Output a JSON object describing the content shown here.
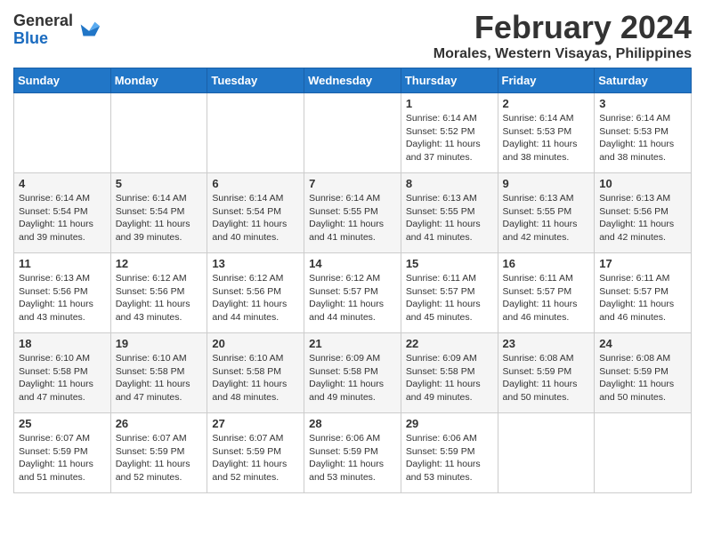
{
  "logo": {
    "general": "General",
    "blue": "Blue"
  },
  "title": {
    "month_year": "February 2024",
    "location": "Morales, Western Visayas, Philippines"
  },
  "headers": [
    "Sunday",
    "Monday",
    "Tuesday",
    "Wednesday",
    "Thursday",
    "Friday",
    "Saturday"
  ],
  "weeks": [
    [
      {
        "day": "",
        "info": ""
      },
      {
        "day": "",
        "info": ""
      },
      {
        "day": "",
        "info": ""
      },
      {
        "day": "",
        "info": ""
      },
      {
        "day": "1",
        "info": "Sunrise: 6:14 AM\nSunset: 5:52 PM\nDaylight: 11 hours\nand 37 minutes."
      },
      {
        "day": "2",
        "info": "Sunrise: 6:14 AM\nSunset: 5:53 PM\nDaylight: 11 hours\nand 38 minutes."
      },
      {
        "day": "3",
        "info": "Sunrise: 6:14 AM\nSunset: 5:53 PM\nDaylight: 11 hours\nand 38 minutes."
      }
    ],
    [
      {
        "day": "4",
        "info": "Sunrise: 6:14 AM\nSunset: 5:54 PM\nDaylight: 11 hours\nand 39 minutes."
      },
      {
        "day": "5",
        "info": "Sunrise: 6:14 AM\nSunset: 5:54 PM\nDaylight: 11 hours\nand 39 minutes."
      },
      {
        "day": "6",
        "info": "Sunrise: 6:14 AM\nSunset: 5:54 PM\nDaylight: 11 hours\nand 40 minutes."
      },
      {
        "day": "7",
        "info": "Sunrise: 6:14 AM\nSunset: 5:55 PM\nDaylight: 11 hours\nand 41 minutes."
      },
      {
        "day": "8",
        "info": "Sunrise: 6:13 AM\nSunset: 5:55 PM\nDaylight: 11 hours\nand 41 minutes."
      },
      {
        "day": "9",
        "info": "Sunrise: 6:13 AM\nSunset: 5:55 PM\nDaylight: 11 hours\nand 42 minutes."
      },
      {
        "day": "10",
        "info": "Sunrise: 6:13 AM\nSunset: 5:56 PM\nDaylight: 11 hours\nand 42 minutes."
      }
    ],
    [
      {
        "day": "11",
        "info": "Sunrise: 6:13 AM\nSunset: 5:56 PM\nDaylight: 11 hours\nand 43 minutes."
      },
      {
        "day": "12",
        "info": "Sunrise: 6:12 AM\nSunset: 5:56 PM\nDaylight: 11 hours\nand 43 minutes."
      },
      {
        "day": "13",
        "info": "Sunrise: 6:12 AM\nSunset: 5:56 PM\nDaylight: 11 hours\nand 44 minutes."
      },
      {
        "day": "14",
        "info": "Sunrise: 6:12 AM\nSunset: 5:57 PM\nDaylight: 11 hours\nand 44 minutes."
      },
      {
        "day": "15",
        "info": "Sunrise: 6:11 AM\nSunset: 5:57 PM\nDaylight: 11 hours\nand 45 minutes."
      },
      {
        "day": "16",
        "info": "Sunrise: 6:11 AM\nSunset: 5:57 PM\nDaylight: 11 hours\nand 46 minutes."
      },
      {
        "day": "17",
        "info": "Sunrise: 6:11 AM\nSunset: 5:57 PM\nDaylight: 11 hours\nand 46 minutes."
      }
    ],
    [
      {
        "day": "18",
        "info": "Sunrise: 6:10 AM\nSunset: 5:58 PM\nDaylight: 11 hours\nand 47 minutes."
      },
      {
        "day": "19",
        "info": "Sunrise: 6:10 AM\nSunset: 5:58 PM\nDaylight: 11 hours\nand 47 minutes."
      },
      {
        "day": "20",
        "info": "Sunrise: 6:10 AM\nSunset: 5:58 PM\nDaylight: 11 hours\nand 48 minutes."
      },
      {
        "day": "21",
        "info": "Sunrise: 6:09 AM\nSunset: 5:58 PM\nDaylight: 11 hours\nand 49 minutes."
      },
      {
        "day": "22",
        "info": "Sunrise: 6:09 AM\nSunset: 5:58 PM\nDaylight: 11 hours\nand 49 minutes."
      },
      {
        "day": "23",
        "info": "Sunrise: 6:08 AM\nSunset: 5:59 PM\nDaylight: 11 hours\nand 50 minutes."
      },
      {
        "day": "24",
        "info": "Sunrise: 6:08 AM\nSunset: 5:59 PM\nDaylight: 11 hours\nand 50 minutes."
      }
    ],
    [
      {
        "day": "25",
        "info": "Sunrise: 6:07 AM\nSunset: 5:59 PM\nDaylight: 11 hours\nand 51 minutes."
      },
      {
        "day": "26",
        "info": "Sunrise: 6:07 AM\nSunset: 5:59 PM\nDaylight: 11 hours\nand 52 minutes."
      },
      {
        "day": "27",
        "info": "Sunrise: 6:07 AM\nSunset: 5:59 PM\nDaylight: 11 hours\nand 52 minutes."
      },
      {
        "day": "28",
        "info": "Sunrise: 6:06 AM\nSunset: 5:59 PM\nDaylight: 11 hours\nand 53 minutes."
      },
      {
        "day": "29",
        "info": "Sunrise: 6:06 AM\nSunset: 5:59 PM\nDaylight: 11 hours\nand 53 minutes."
      },
      {
        "day": "",
        "info": ""
      },
      {
        "day": "",
        "info": ""
      }
    ]
  ]
}
